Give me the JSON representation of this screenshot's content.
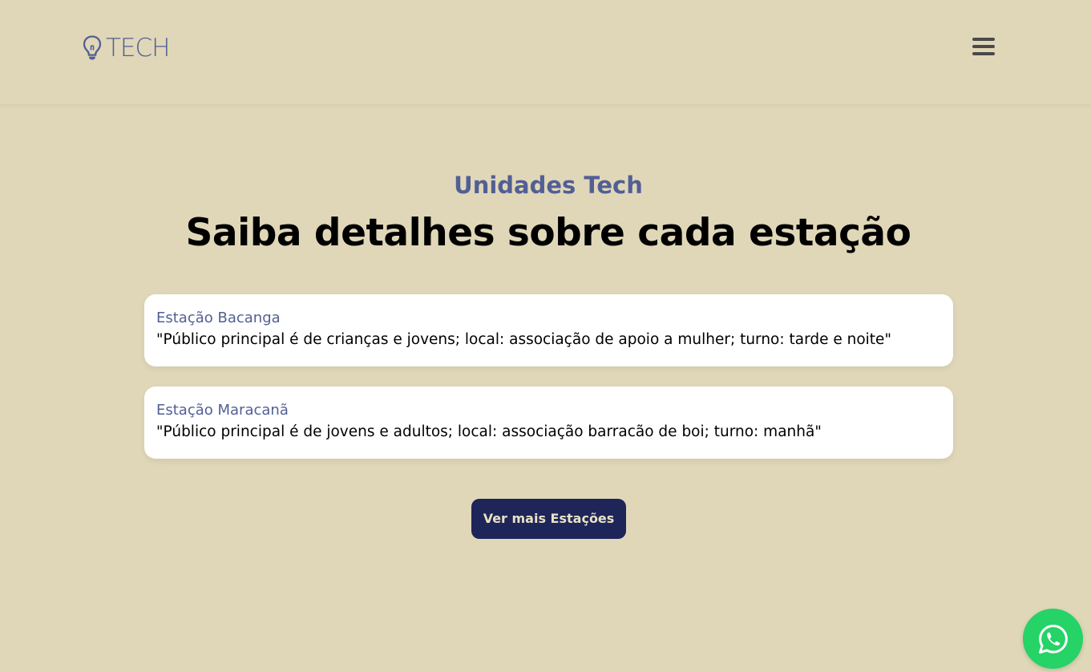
{
  "header": {
    "logo_text": "TECH",
    "logo_icon": "lightbulb-icon",
    "menu_icon": "hamburger-menu-icon"
  },
  "section": {
    "eyebrow": "Unidades Tech",
    "headline": "Saiba detalhes sobre cada estação",
    "stations": [
      {
        "name": "Estação Bacanga",
        "description": "\"Público principal é de crianças e jovens; local: associação de apoio a mulher; turno: tarde e noite\""
      },
      {
        "name": "Estação Maracanã",
        "description": "\"Público principal é de jovens e adultos; local: associação barracão de boi; turno: manhã\""
      }
    ],
    "cta_label": "Ver mais Estações"
  },
  "floating": {
    "whatsapp_icon": "whatsapp-icon"
  },
  "colors": {
    "background": "#e0d7b8",
    "accent": "#525f94",
    "button": "#1e2558",
    "whatsapp": "#25d366"
  }
}
